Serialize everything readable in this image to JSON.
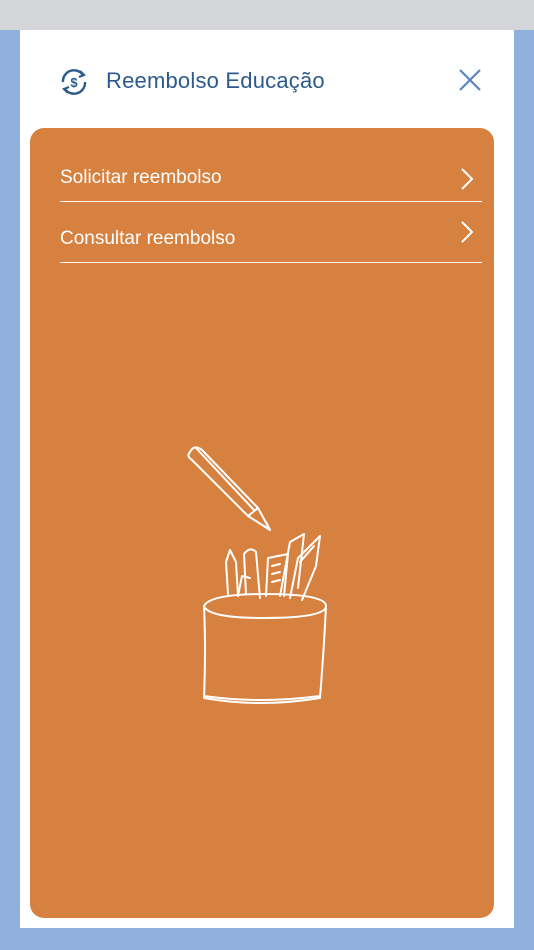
{
  "header": {
    "title": "Reembolso Educação",
    "icon": "refund-currency-icon",
    "close_icon": "close-icon",
    "accent_color": "#2d5a8c"
  },
  "card": {
    "background": "#d68140",
    "menu": [
      {
        "label": "Solicitar reembolso",
        "icon": "chevron-right-icon"
      },
      {
        "label": "Consultar reembolso",
        "icon": "chevron-right-icon"
      }
    ],
    "illustration": "pencil-cup-illustration"
  }
}
